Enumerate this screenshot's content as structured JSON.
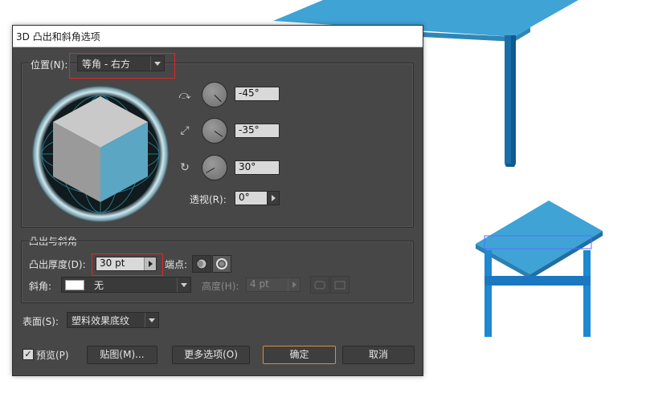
{
  "dialog": {
    "title": "3D 凸出和斜角选项",
    "position_label": "位置(N):",
    "position_value": "等角 - 右方",
    "rotation": {
      "x_value": "-45°",
      "y_value": "-35°",
      "z_value": "30°"
    },
    "perspective_label": "透视(R):",
    "perspective_value": "0°",
    "extrude_section_label": "凸出与斜角",
    "extrude_depth_label": "凸出厚度(D):",
    "extrude_depth_value": "30 pt",
    "cap_label": "端点:",
    "bevel_label": "斜角:",
    "bevel_value": "无",
    "height_label": "高度(H):",
    "height_value": "4 pt",
    "surface_label": "表面(S):",
    "surface_value": "塑料效果底纹",
    "preview_label": "预览(P)",
    "map_button": "贴图(M)...",
    "more_options_button": "更多选项(O)",
    "ok_button": "确定",
    "cancel_button": "取消"
  },
  "colors": {
    "table_top": "#3fa3d6",
    "table_leg": "#1a6fa8",
    "table_leg_dark": "#0f5a8f",
    "accent_orange": "#e08a3a",
    "highlight_red": "#e0262a",
    "cube_right": "#5aa6c3"
  },
  "icons": [
    "x-axis-rotate-icon",
    "y-axis-rotate-icon",
    "z-axis-rotate-icon",
    "cap-on-icon",
    "cap-off-icon",
    "bevel-out-icon",
    "bevel-in-icon",
    "dropdown-arrow-icon",
    "stepper-arrow-icon"
  ]
}
